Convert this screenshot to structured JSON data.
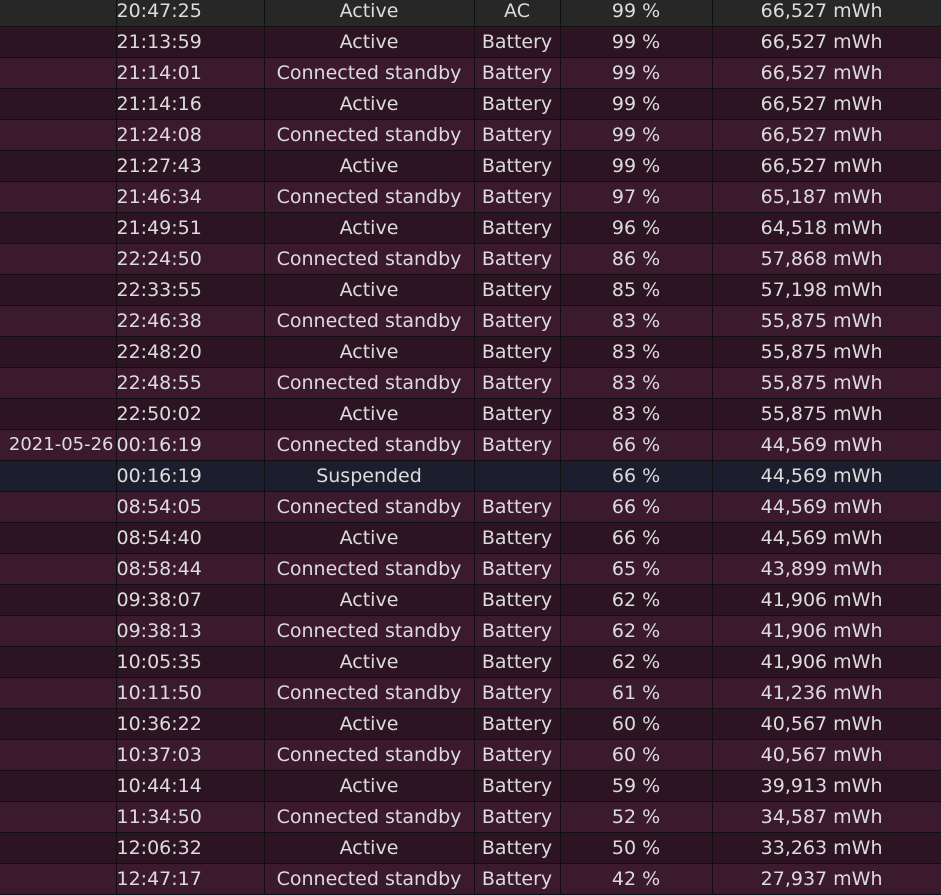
{
  "rows": [
    {
      "date": "",
      "time": "20:47:25",
      "state": "Active",
      "source": "AC",
      "percent": "99 %",
      "capacity": "66,527 mWh",
      "kind": "ac"
    },
    {
      "date": "",
      "time": "21:13:59",
      "state": "Active",
      "source": "Battery",
      "percent": "99 %",
      "capacity": "66,527 mWh",
      "kind": "odd"
    },
    {
      "date": "",
      "time": "21:14:01",
      "state": "Connected standby",
      "source": "Battery",
      "percent": "99 %",
      "capacity": "66,527 mWh",
      "kind": "even"
    },
    {
      "date": "",
      "time": "21:14:16",
      "state": "Active",
      "source": "Battery",
      "percent": "99 %",
      "capacity": "66,527 mWh",
      "kind": "odd"
    },
    {
      "date": "",
      "time": "21:24:08",
      "state": "Connected standby",
      "source": "Battery",
      "percent": "99 %",
      "capacity": "66,527 mWh",
      "kind": "even"
    },
    {
      "date": "",
      "time": "21:27:43",
      "state": "Active",
      "source": "Battery",
      "percent": "99 %",
      "capacity": "66,527 mWh",
      "kind": "odd"
    },
    {
      "date": "",
      "time": "21:46:34",
      "state": "Connected standby",
      "source": "Battery",
      "percent": "97 %",
      "capacity": "65,187 mWh",
      "kind": "even"
    },
    {
      "date": "",
      "time": "21:49:51",
      "state": "Active",
      "source": "Battery",
      "percent": "96 %",
      "capacity": "64,518 mWh",
      "kind": "odd"
    },
    {
      "date": "",
      "time": "22:24:50",
      "state": "Connected standby",
      "source": "Battery",
      "percent": "86 %",
      "capacity": "57,868 mWh",
      "kind": "even"
    },
    {
      "date": "",
      "time": "22:33:55",
      "state": "Active",
      "source": "Battery",
      "percent": "85 %",
      "capacity": "57,198 mWh",
      "kind": "odd"
    },
    {
      "date": "",
      "time": "22:46:38",
      "state": "Connected standby",
      "source": "Battery",
      "percent": "83 %",
      "capacity": "55,875 mWh",
      "kind": "even"
    },
    {
      "date": "",
      "time": "22:48:20",
      "state": "Active",
      "source": "Battery",
      "percent": "83 %",
      "capacity": "55,875 mWh",
      "kind": "odd"
    },
    {
      "date": "",
      "time": "22:48:55",
      "state": "Connected standby",
      "source": "Battery",
      "percent": "83 %",
      "capacity": "55,875 mWh",
      "kind": "even"
    },
    {
      "date": "",
      "time": "22:50:02",
      "state": "Active",
      "source": "Battery",
      "percent": "83 %",
      "capacity": "55,875 mWh",
      "kind": "odd"
    },
    {
      "date": "2021-05-26",
      "time": "00:16:19",
      "state": "Connected standby",
      "source": "Battery",
      "percent": "66 %",
      "capacity": "44,569 mWh",
      "kind": "even"
    },
    {
      "date": "",
      "time": "00:16:19",
      "state": "Suspended",
      "source": "",
      "percent": "66 %",
      "capacity": "44,569 mWh",
      "kind": "suspended"
    },
    {
      "date": "",
      "time": "08:54:05",
      "state": "Connected standby",
      "source": "Battery",
      "percent": "66 %",
      "capacity": "44,569 mWh",
      "kind": "even"
    },
    {
      "date": "",
      "time": "08:54:40",
      "state": "Active",
      "source": "Battery",
      "percent": "66 %",
      "capacity": "44,569 mWh",
      "kind": "odd"
    },
    {
      "date": "",
      "time": "08:58:44",
      "state": "Connected standby",
      "source": "Battery",
      "percent": "65 %",
      "capacity": "43,899 mWh",
      "kind": "even"
    },
    {
      "date": "",
      "time": "09:38:07",
      "state": "Active",
      "source": "Battery",
      "percent": "62 %",
      "capacity": "41,906 mWh",
      "kind": "odd"
    },
    {
      "date": "",
      "time": "09:38:13",
      "state": "Connected standby",
      "source": "Battery",
      "percent": "62 %",
      "capacity": "41,906 mWh",
      "kind": "even"
    },
    {
      "date": "",
      "time": "10:05:35",
      "state": "Active",
      "source": "Battery",
      "percent": "62 %",
      "capacity": "41,906 mWh",
      "kind": "odd"
    },
    {
      "date": "",
      "time": "10:11:50",
      "state": "Connected standby",
      "source": "Battery",
      "percent": "61 %",
      "capacity": "41,236 mWh",
      "kind": "even"
    },
    {
      "date": "",
      "time": "10:36:22",
      "state": "Active",
      "source": "Battery",
      "percent": "60 %",
      "capacity": "40,567 mWh",
      "kind": "odd"
    },
    {
      "date": "",
      "time": "10:37:03",
      "state": "Connected standby",
      "source": "Battery",
      "percent": "60 %",
      "capacity": "40,567 mWh",
      "kind": "even"
    },
    {
      "date": "",
      "time": "10:44:14",
      "state": "Active",
      "source": "Battery",
      "percent": "59 %",
      "capacity": "39,913 mWh",
      "kind": "odd"
    },
    {
      "date": "",
      "time": "11:34:50",
      "state": "Connected standby",
      "source": "Battery",
      "percent": "52 %",
      "capacity": "34,587 mWh",
      "kind": "even"
    },
    {
      "date": "",
      "time": "12:06:32",
      "state": "Active",
      "source": "Battery",
      "percent": "50 %",
      "capacity": "33,263 mWh",
      "kind": "odd"
    },
    {
      "date": "",
      "time": "12:47:17",
      "state": "Connected standby",
      "source": "Battery",
      "percent": "42 %",
      "capacity": "27,937 mWh",
      "kind": "even"
    }
  ]
}
